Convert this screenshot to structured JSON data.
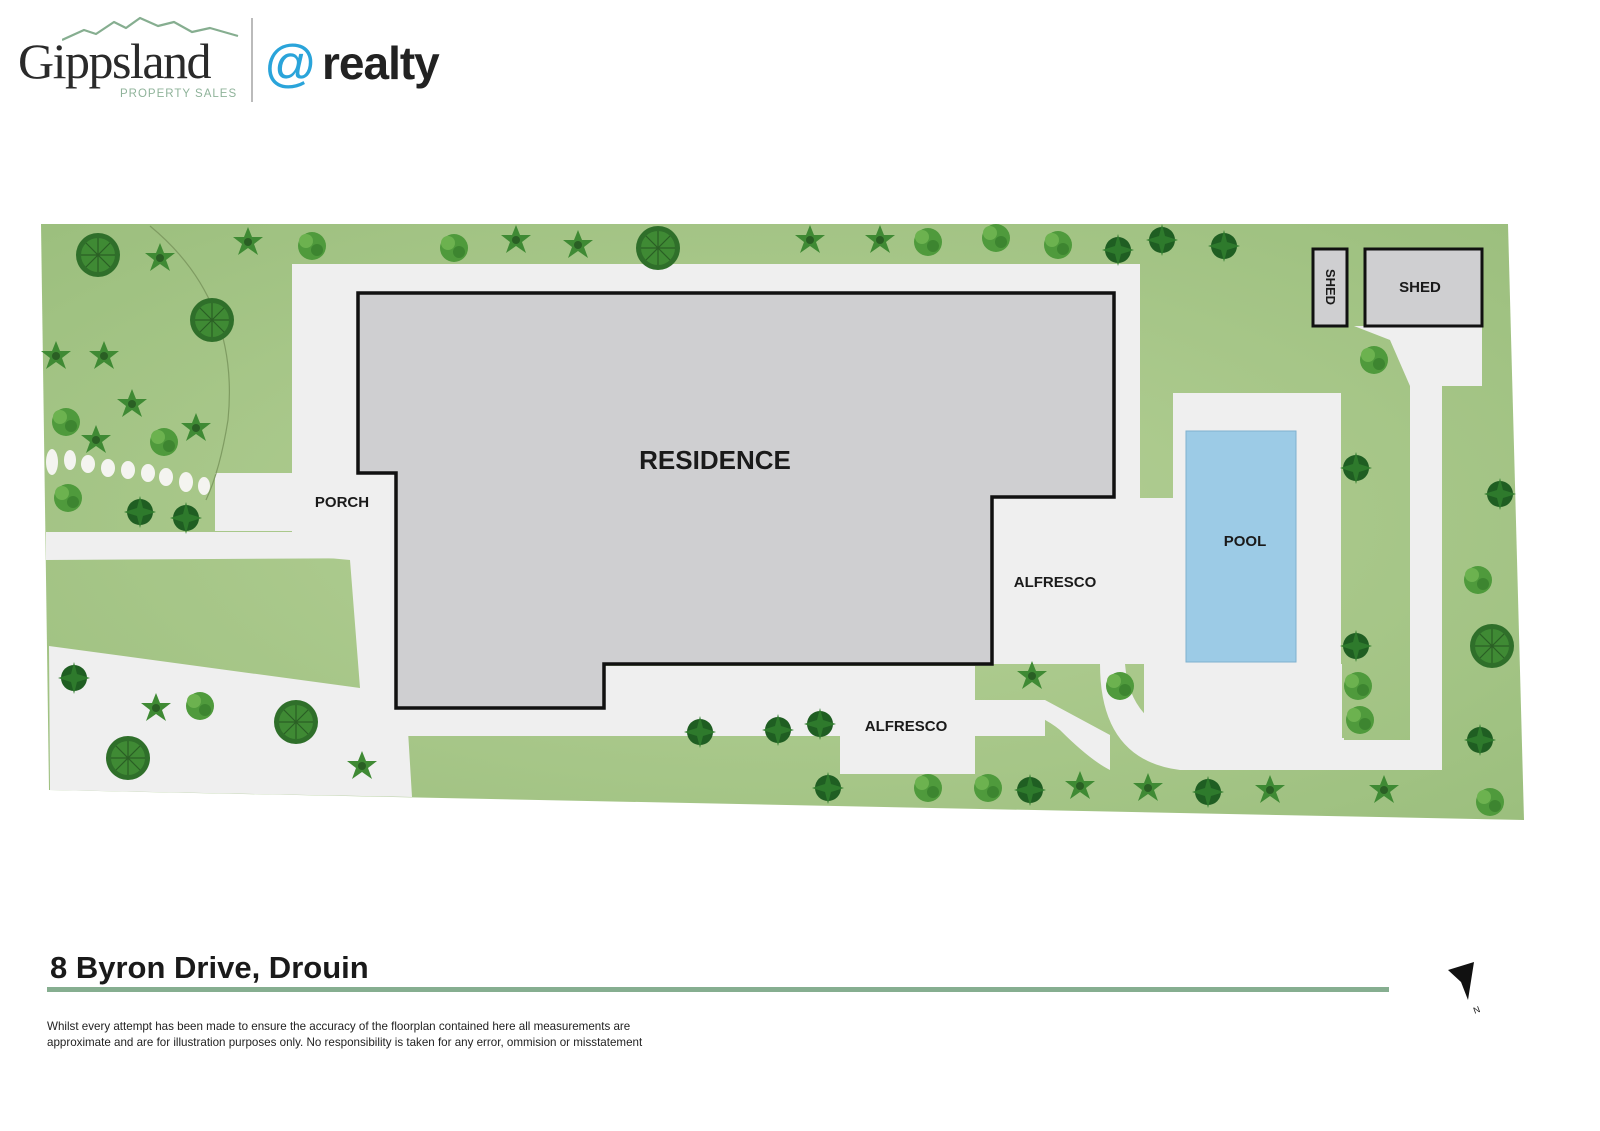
{
  "logo": {
    "brand_name": "Gippsland",
    "brand_sub": "PROPERTY SALES",
    "realty_at": "@",
    "realty_word": "realty"
  },
  "plan": {
    "labels": {
      "residence": "RESIDENCE",
      "porch": "PORCH",
      "alfresco_east": "ALFRESCO",
      "alfresco_south": "ALFRESCO",
      "pool": "POOL",
      "shed_small": "SHED",
      "shed_large": "SHED"
    },
    "colors": {
      "lawn": "#a9c98a",
      "paving": "#efefef",
      "building": "#cfcfd1",
      "pool": "#9ccbe6",
      "outline": "#111111",
      "accent_rule": "#86ae90"
    }
  },
  "footer": {
    "address": "8 Byron Drive, Drouin",
    "disclaimer": "Whilst every attempt has been made to ensure the accuracy of the floorplan contained here all measurements are approximate and are for illustration purposes only. No responsibility is taken for any error, ommision or misstatement",
    "compass_label": "N"
  }
}
